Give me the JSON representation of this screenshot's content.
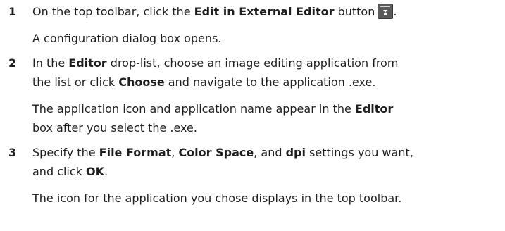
{
  "steps": [
    {
      "number": "1",
      "line1_pre": "On the top toolbar, click the ",
      "line1_ui": "Edit in External Editor",
      "line1_post": " button",
      "line1_end": ".",
      "icon": "edit-in-external-editor-icon",
      "result": "A configuration dialog box opens."
    },
    {
      "number": "2",
      "line1_pre": "In the ",
      "line1_ui": "Editor",
      "line1_post": " drop-list, choose an image editing application from",
      "line2_pre": "the list or click ",
      "line2_ui": "Choose",
      "line2_post": " and navigate to the application .exe.",
      "result_line1_pre": "The application icon and application name appear in the ",
      "result_line1_ui": "Editor",
      "result_line2": "box after you select the .exe."
    },
    {
      "number": "3",
      "line1_pre": "Specify the ",
      "line1_ui1": "File Format",
      "line1_mid1": ", ",
      "line1_ui2": "Color Space",
      "line1_mid2": ", and ",
      "line1_ui3": "dpi",
      "line1_post": " settings you want,",
      "line2_pre": "and click ",
      "line2_ui": "OK",
      "line2_post": ".",
      "result": "The icon for the application you chose displays in the top toolbar."
    }
  ]
}
